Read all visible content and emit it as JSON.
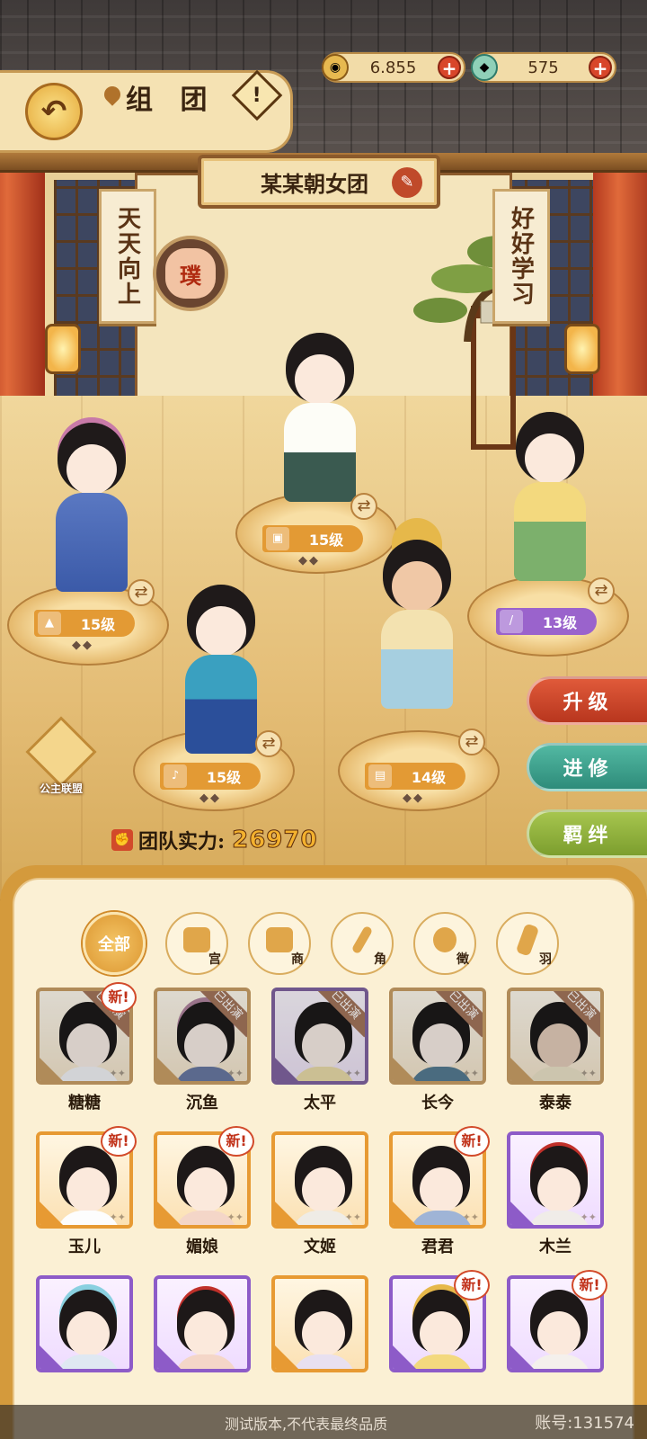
{
  "header": {
    "title": "组 团",
    "back_icon": "back-arrow-icon",
    "help_icon": "exclamation-icon"
  },
  "currencies": [
    {
      "icon": "coin-icon",
      "value": "6.855"
    },
    {
      "icon": "jade-icon",
      "value": "575"
    }
  ],
  "team": {
    "name": "某某朝女团",
    "badge": "璞",
    "power_label": "团队实力:",
    "power_value": "26970"
  },
  "scrolls": {
    "left": "天天向上",
    "right": "好好学习"
  },
  "lineup": [
    {
      "level": "15级",
      "color": "#e39a34"
    },
    {
      "level": "15级",
      "color": "#e39a34"
    },
    {
      "level": "13级",
      "color": "#9a63cc"
    },
    {
      "level": "15级",
      "color": "#e39a34"
    },
    {
      "level": "14级",
      "color": "#e39a34"
    }
  ],
  "side_buttons": {
    "upgrade": "升级",
    "advance": "进修",
    "bond": "羁绊"
  },
  "alliance_label": "公主联盟",
  "filters": {
    "all": "全部",
    "gong": "宫",
    "shang": "商",
    "jiao": "角",
    "zhi": "徵",
    "yu": "羽"
  },
  "tags": {
    "new": "新!",
    "performing": "已出演"
  },
  "roster": [
    {
      "name": "糖糖"
    },
    {
      "name": "沉鱼"
    },
    {
      "name": "太平"
    },
    {
      "name": "长今"
    },
    {
      "name": "泰泰"
    },
    {
      "name": "玉儿"
    },
    {
      "name": "媚娘"
    },
    {
      "name": "文姬"
    },
    {
      "name": "君君"
    },
    {
      "name": "木兰"
    },
    {
      "name": ""
    },
    {
      "name": ""
    },
    {
      "name": ""
    },
    {
      "name": ""
    },
    {
      "name": ""
    }
  ],
  "footer": {
    "note": "测试版本,不代表最终品质",
    "account": "账号:131574"
  },
  "colors": {
    "orange_rarity": "#e79a33",
    "purple_rarity": "#8d5bc8",
    "upgrade_btn": "#c8432a",
    "advance_btn": "#3a9e8a",
    "bond_btn": "#8fb33c"
  }
}
